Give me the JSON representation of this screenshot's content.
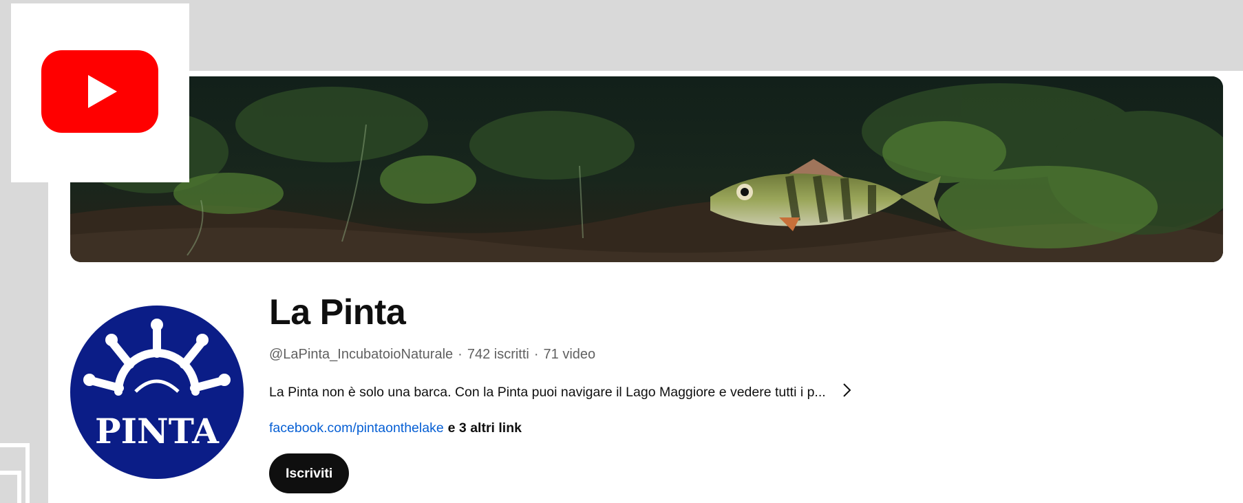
{
  "channel": {
    "name": "La Pinta",
    "handle": "@LaPinta_IncubatoioNaturale",
    "separator": "·",
    "subscribers": "742 iscritti",
    "videos": "71 video",
    "description": "La Pinta non è solo una barca. Con la Pinta puoi navigare il Lago Maggiore e vedere tutti i p...",
    "link": "facebook.com/pintaonthelake",
    "more_links": "e 3 altri link",
    "subscribe_label": "Iscriviti",
    "avatar_text": "PINTA"
  },
  "icons": {
    "logo": "youtube-logo-icon",
    "description_more": "chevron-right-icon"
  },
  "colors": {
    "youtube_red": "#ff0000",
    "link_blue": "#065fd4",
    "avatar_navy": "#0b1d87",
    "subscribe_bg": "#0f0f0f",
    "frame_gray": "#d9d9d9"
  }
}
